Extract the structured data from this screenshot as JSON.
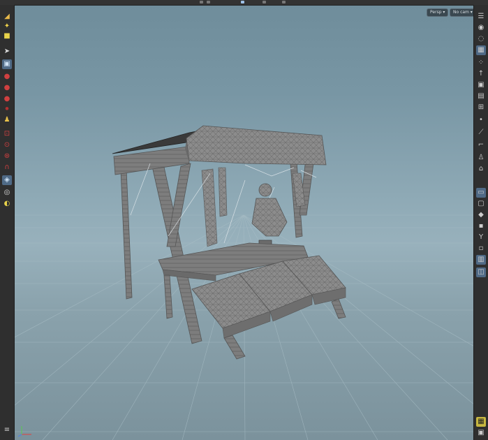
{
  "top_menu": {
    "icons": [
      "chevron-left-icon",
      "chevron-right-icon",
      "camera-icon",
      "grid-icon",
      "settings-icon"
    ]
  },
  "left_toolbar": {
    "tools": [
      {
        "name": "select-tool",
        "icon": "arrow-cursor-icon",
        "color": "#e8b94a",
        "active": false
      },
      {
        "name": "move-tool",
        "icon": "arrows-move-icon",
        "color": "#f0d24a",
        "active": false
      },
      {
        "name": "paint-tool",
        "icon": "pencil-icon",
        "color": "#e8d34a",
        "active": false
      },
      {
        "name": "pointer-tool",
        "icon": "pointer-icon",
        "color": "#cccccc",
        "active": false
      },
      {
        "name": "select-box-tool",
        "icon": "square-icon",
        "color": "#9ec2e8",
        "active": true
      },
      {
        "name": "handle-tool",
        "icon": "dot-red-icon",
        "color": "#d04040",
        "active": false
      },
      {
        "name": "translate-tool",
        "icon": "dot-red-icon",
        "color": "#d04040",
        "active": false
      },
      {
        "name": "rotate-tool",
        "icon": "dot-red-icon",
        "color": "#d04040",
        "active": false
      },
      {
        "name": "scale-tool",
        "icon": "dot-red-icon",
        "color": "#b03030",
        "active": false
      },
      {
        "name": "pose-tool",
        "icon": "figure-icon",
        "color": "#e8c24a",
        "active": false
      },
      {
        "name": "brush-tool",
        "icon": "brush-icon",
        "color": "#d04040",
        "active": false
      },
      {
        "name": "lasso-tool",
        "icon": "lasso-icon",
        "color": "#d04040",
        "active": false
      },
      {
        "name": "snap-tool",
        "icon": "magnet-icon",
        "color": "#d04040",
        "active": false
      },
      {
        "name": "view-tool",
        "icon": "eye-icon",
        "color": "#9ec2e8",
        "active": true
      },
      {
        "name": "camera-tool",
        "icon": "camera-lens-icon",
        "color": "#dddddd",
        "active": false
      },
      {
        "name": "flashlight-tool",
        "icon": "light-icon",
        "color": "#e8d34a",
        "active": false
      }
    ]
  },
  "right_toolbar": {
    "tools": [
      {
        "name": "display-options",
        "icon": "menu-icon",
        "active": false
      },
      {
        "name": "shading-mode",
        "icon": "sphere-icon",
        "active": false
      },
      {
        "name": "lights",
        "icon": "bulb-icon",
        "active": false
      },
      {
        "name": "wireframe",
        "icon": "cube-icon",
        "active": true
      },
      {
        "name": "points",
        "icon": "dots-icon",
        "active": false
      },
      {
        "name": "normals",
        "icon": "arrow-up-icon",
        "active": false
      },
      {
        "name": "camera-persp",
        "icon": "camera-icon",
        "active": false
      },
      {
        "name": "background",
        "icon": "image-icon",
        "active": false
      },
      {
        "name": "grid",
        "icon": "grid-icon",
        "active": false
      },
      {
        "name": "snapping",
        "icon": "magnet-icon",
        "active": false
      },
      {
        "name": "safe-area",
        "icon": "frame-icon",
        "active": true
      },
      {
        "name": "handles",
        "icon": "gizmo-icon",
        "active": false
      },
      {
        "name": "guides",
        "icon": "guide-icon",
        "active": false
      },
      {
        "name": "visualizers",
        "icon": "eye-icon",
        "active": true
      },
      {
        "name": "scene-view",
        "icon": "cube-outline-icon",
        "active": true
      }
    ]
  },
  "viewport": {
    "perspective_button": "Persp ▾",
    "camera_button": "No cam ▾",
    "sky_color": "#7896a4",
    "floor_color": "#8ba3ad",
    "model_color": "#8e8e8e"
  },
  "status_bar": {
    "axes_icon": "axes-gizmo-icon"
  }
}
